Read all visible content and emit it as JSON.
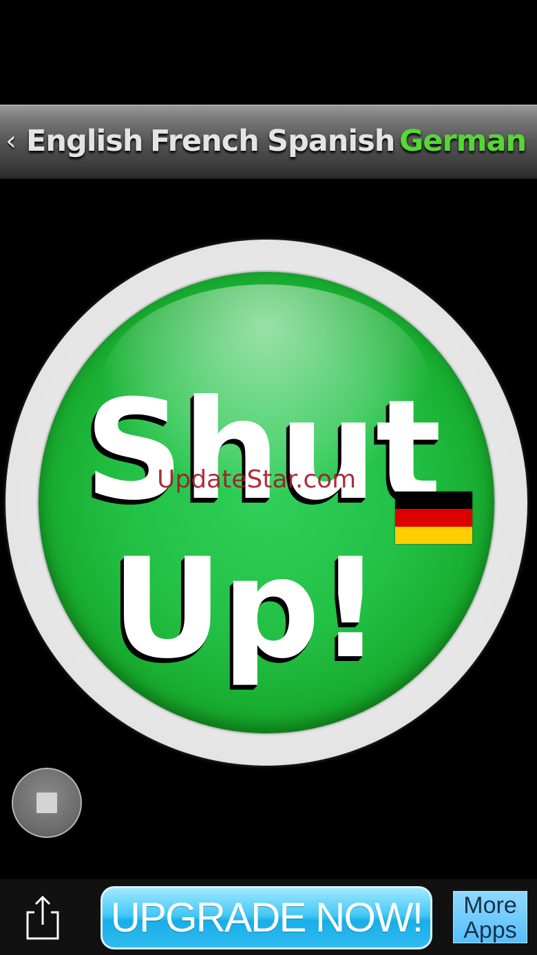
{
  "language_bar": {
    "back_glyph": "‹",
    "tabs": [
      {
        "label": "English",
        "active": false
      },
      {
        "label": "French",
        "active": false
      },
      {
        "label": "Spanish",
        "active": false
      },
      {
        "label": "German",
        "active": true
      }
    ],
    "active_color": "#55d834"
  },
  "main_button": {
    "line1": "Shut",
    "line2": "Up!",
    "color": "#22bf44",
    "flag": {
      "country": "Germany",
      "colors": [
        "#000000",
        "#dd0000",
        "#ffce00"
      ]
    }
  },
  "watermark": "UpdateStar.com",
  "stop_button": {
    "icon": "stop-icon"
  },
  "toolbar": {
    "share_icon": "share-icon",
    "upgrade_label": "UPGRADE NOW!",
    "more_apps_line1": "More",
    "more_apps_line2": "Apps"
  }
}
